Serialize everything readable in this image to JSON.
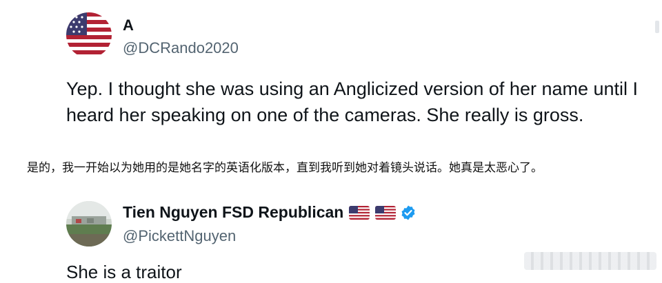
{
  "post": {
    "display_name": "A",
    "handle": "@DCRando2020",
    "text_lines": [
      "Yep. I thought she was using an Anglicized version of her name until I",
      "heard her speaking on one of the cameras. She really is gross."
    ],
    "avatar_icon": "us-flag-avatar"
  },
  "translation": {
    "text": "是的，我一开始以为她用的是她名字的英语化版本，直到我听到她对着镜头说话。她真是太恶心了。"
  },
  "reply": {
    "display_name": "Tien Nguyen FSD Republican",
    "handle": "@PickettNguyen",
    "text": "She is a traitor",
    "badges": [
      "us-flag-icon",
      "us-flag-icon",
      "verified-badge-icon"
    ],
    "avatar_icon": "landscape-photo-avatar"
  },
  "colors": {
    "text": "#0f1419",
    "secondary": "#536471",
    "verified": "#1d9bf0",
    "flag_red": "#b22234",
    "flag_blue": "#3c3b6e"
  }
}
